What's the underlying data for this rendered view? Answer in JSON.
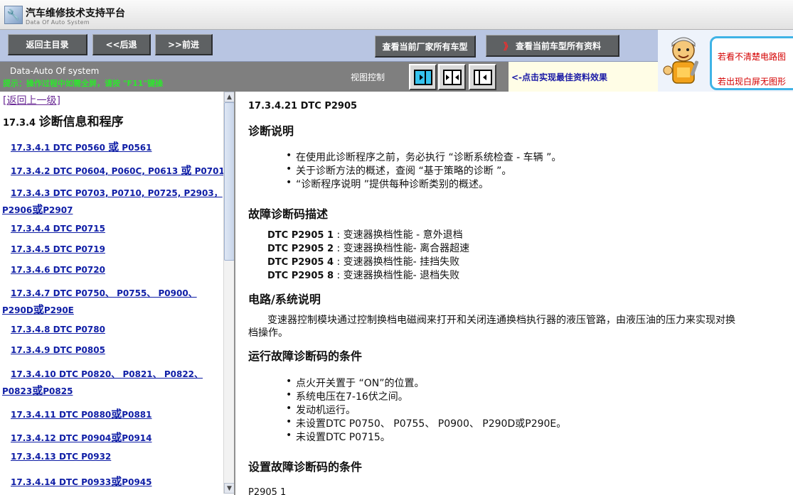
{
  "app": {
    "title": "汽车维修技术支持平台",
    "subtitle": "Data Of Auto System",
    "logo_icon": "wrench-logo-icon"
  },
  "toolbar": {
    "home_label": "返回主目录",
    "back_label": "<<后退",
    "forward_label": ">>前进",
    "maker_models_label": "查看当前厂家所有车型",
    "model_docs_arrows": "》",
    "model_docs_label": "查看当前车型所有资料"
  },
  "help": {
    "line_1": "若看不清楚电路图",
    "line_2": "若出现白屏无图形",
    "mascot_icon": "mechanic-mascot-icon"
  },
  "viewbar": {
    "system_name": "Data-Auto Of system",
    "notice": "提示：操作过程中如需全屏，请按 \"F11\"键操",
    "view_label": "视图控制",
    "hint": "<-点击实现最佳资料效果",
    "buttons": [
      "show-left-pane-icon",
      "split-view-icon",
      "hide-left-pane-icon"
    ]
  },
  "toc": {
    "back_up": "[返回上一级]",
    "section_number": "17.3.4",
    "section_title": "诊断信息和程序",
    "items": [
      {
        "a": "17.3.4.1 DTC P0560 ",
        "b": "或",
        "c": " P0561"
      },
      {
        "a": "17.3.4.2 DTC P0604, P060C, P0613 ",
        "b": "或",
        "c": " P0701"
      },
      {
        "a": "17.3.4.3 DTC P0703, P0710, P0725, P2903，",
        "b": "",
        "c": ""
      },
      {
        "a": "P2906",
        "b": "或",
        "c": "P2907"
      },
      {
        "a": "17.3.4.4 DTC P0715",
        "b": "",
        "c": ""
      },
      {
        "a": "17.3.4.5 DTC P0719",
        "b": "",
        "c": ""
      },
      {
        "a": "17.3.4.6 DTC P0720",
        "b": "",
        "c": ""
      },
      {
        "a": "17.3.4.7 DTC P0750、 P0755、 P0900、",
        "b": "",
        "c": ""
      },
      {
        "a": "P290D",
        "b": "或",
        "c": "P290E"
      },
      {
        "a": "17.3.4.8 DTC P0780",
        "b": "",
        "c": ""
      },
      {
        "a": "17.3.4.9 DTC P0805",
        "b": "",
        "c": ""
      },
      {
        "a": "17.3.4.10 DTC P0820、 P0821、 P0822、",
        "b": "",
        "c": ""
      },
      {
        "a": "P0823",
        "b": "或",
        "c": "P0825"
      },
      {
        "a": "17.3.4.11 DTC P0880",
        "b": "或",
        "c": "P0881"
      },
      {
        "a": "17.3.4.12 DTC P0904",
        "b": "或",
        "c": "P0914"
      },
      {
        "a": "17.3.4.13 DTC P0932",
        "b": "",
        "c": ""
      },
      {
        "a": "17.3.4.14 DTC P0933",
        "b": "或",
        "c": "P0945"
      }
    ]
  },
  "doc": {
    "heading": "17.3.4.21 DTC P2905",
    "diag_title": "诊断说明",
    "diag_bullets": [
      "在使用此诊断程序之前，务必执行 “诊断系统检查 - 车辆 ”。",
      "关于诊断方法的概述，查阅 “基于策略的诊断 ”。",
      "“诊断程序说明 ”提供每种诊断类别的概述。"
    ],
    "dtc_title": "故障诊断码描述",
    "dtc_lines": [
      {
        "code": "DTC P2905 1",
        "desc": "变速器换档性能 - 意外退档"
      },
      {
        "code": "DTC P2905 2",
        "desc": "变速器换档性能- 离合器超速"
      },
      {
        "code": "DTC P2905 4",
        "desc": "变速器换档性能- 挂挡失败"
      },
      {
        "code": "DTC P2905 8",
        "desc": "变速器换档性能- 退档失败"
      }
    ],
    "circuit_title": "电路/系统说明",
    "circuit_line_1": "变速器控制模块通过控制换档电磁阀来打开和关闭连通换档执行器的液压管路，由液压油的压力来实现对换",
    "circuit_line_2": "档操作。",
    "run_title": "运行故障诊断码的条件",
    "run_bullets": [
      "点火开关置于 “ON”的位置。",
      "系统电压在7-16伏之间。",
      "发动机运行。",
      "未设置DTC P0750、 P0755、 P0900、 P290D或P290E。",
      "未设置DTC P0715。"
    ],
    "set_title": "设置故障诊断码的条件",
    "cutoff_line": "P2905 1"
  }
}
